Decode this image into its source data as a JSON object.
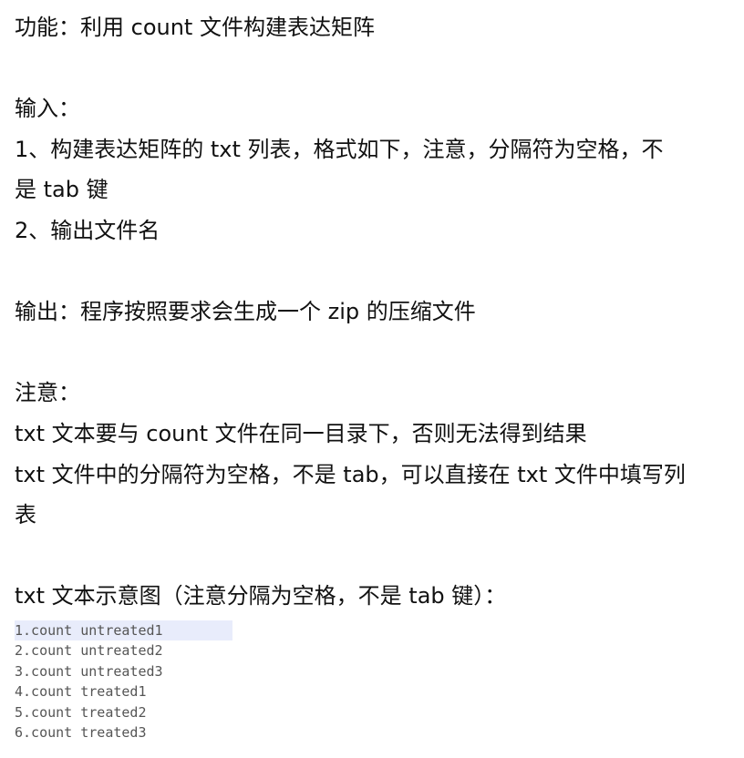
{
  "document": {
    "function_line": "功能：利用 count 文件构建表达矩阵",
    "input_heading": "输入：",
    "input_item_1_line_1": "1、构建表达矩阵的 txt 列表，格式如下，注意，分隔符为空格，不",
    "input_item_1_line_2": "是 tab 键",
    "input_item_2": "2、输出文件名",
    "output_line": "输出：程序按照要求会生成一个 zip 的压缩文件",
    "note_heading": "注意：",
    "note_line_1": "txt 文本要与 count 文件在同一目录下，否则无法得到结果",
    "note_line_2_part_1": "txt 文件中的分隔符为空格，不是 tab，可以直接在 txt 文件中填写列",
    "note_line_2_part_2": "表",
    "example_caption": "txt 文本示意图（注意分隔为空格，不是 tab 键）："
  },
  "example_file": {
    "rows": [
      "1.count untreated1",
      "2.count untreated2",
      "3.count untreated3",
      "4.count treated1",
      "5.count treated2",
      "6.count treated3"
    ]
  }
}
